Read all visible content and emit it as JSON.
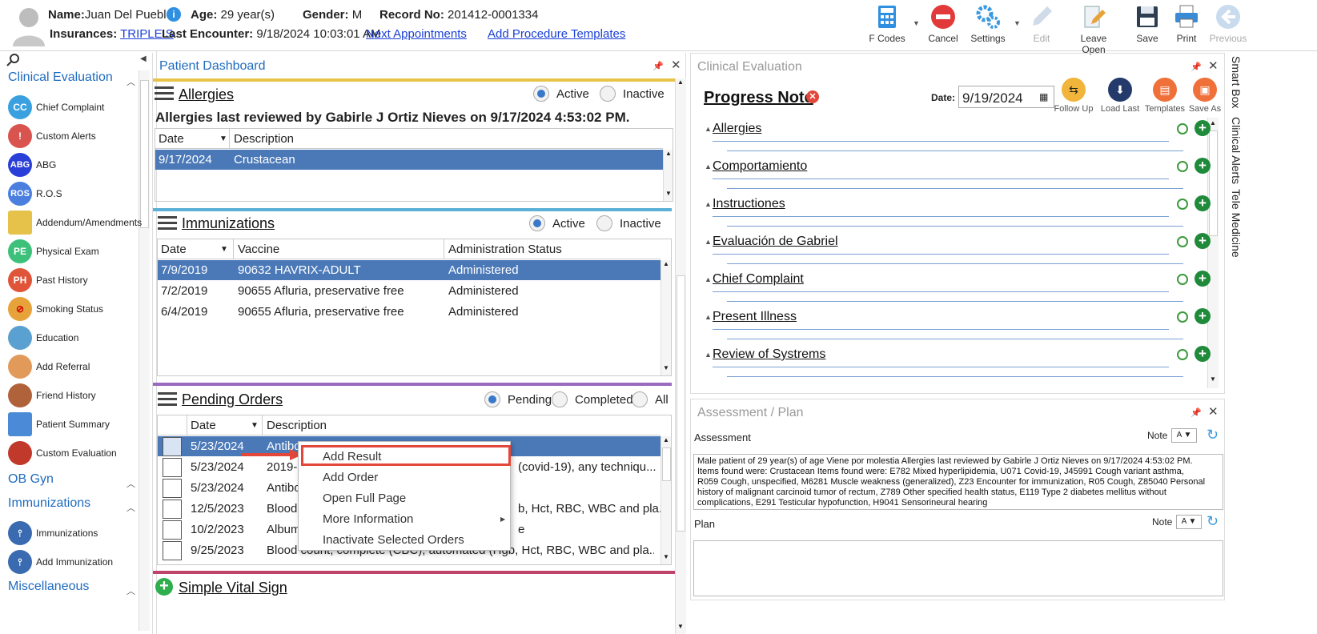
{
  "patient": {
    "name_label": "Name:",
    "name": "Juan Del Pueblo",
    "age_label": "Age:",
    "age": "29 year(s)",
    "gender_label": "Gender:",
    "gender": "M",
    "record_label": "Record No:",
    "record": "201412-0001334",
    "insurances_label": "Insurances:",
    "insurance": "TRIPLE S",
    "last_encounter_label": "Last Encounter:",
    "last_encounter": "9/18/2024 10:03:01 AM",
    "next_appointments": "Next Appointments",
    "add_procedure_templates": "Add Procedure Templates"
  },
  "toolbar": {
    "fcodes": "F Codes",
    "cancel": "Cancel",
    "settings": "Settings",
    "edit": "Edit",
    "leave_open": "Leave Open",
    "save": "Save",
    "print": "Print",
    "previous": "Previous"
  },
  "sidebar": {
    "sections": [
      "Clinical Evaluation",
      "OB Gyn",
      "Immunizations",
      "Miscellaneous"
    ],
    "items": [
      {
        "label": "Chief Complaint",
        "badge": "CC",
        "color": "#3aa0e0"
      },
      {
        "label": "Custom Alerts",
        "badge": "!",
        "color": "#d9534f"
      },
      {
        "label": "ABG",
        "badge": "ABG",
        "color": "#2a3fd8"
      },
      {
        "label": "R.O.S",
        "badge": "ROS",
        "color": "#4a7fe0"
      },
      {
        "label": "Addendum/Amendments",
        "badge": "",
        "color": "#e6c24a"
      },
      {
        "label": "Physical Exam",
        "badge": "PE",
        "color": "#3cc07a"
      },
      {
        "label": "Past History",
        "badge": "PH",
        "color": "#e0553a"
      },
      {
        "label": "Smoking Status",
        "badge": "⊘",
        "color": "#e8a23a"
      },
      {
        "label": "Education",
        "badge": "",
        "color": "#5aa0d0"
      },
      {
        "label": "Add Referral",
        "badge": "",
        "color": "#e29a5a"
      },
      {
        "label": "Friend History",
        "badge": "",
        "color": "#b0623a"
      },
      {
        "label": "Patient Summary",
        "badge": "",
        "color": "#4a8ad6"
      },
      {
        "label": "Custom Evaluation",
        "badge": "",
        "color": "#c0392b"
      }
    ],
    "imm_items": [
      {
        "label": "Immunizations",
        "color": "#3a6ab0"
      },
      {
        "label": "Add Immunization",
        "color": "#3a6ab0"
      }
    ]
  },
  "dashboard": {
    "title": "Patient Dashboard",
    "allergies": {
      "title": "Allergies",
      "active": "Active",
      "inactive": "Inactive",
      "reviewed": "Allergies last reviewed by Gabirle J Ortiz Nieves on 9/17/2024 4:53:02 PM.",
      "columns": [
        "Date",
        "Description"
      ],
      "rows": [
        [
          "9/17/2024",
          "Crustacean"
        ]
      ]
    },
    "immunizations": {
      "title": "Immunizations",
      "active": "Active",
      "inactive": "Inactive",
      "columns": [
        "Date",
        "Vaccine",
        "Administration Status"
      ],
      "rows": [
        [
          "7/9/2019",
          "90632 HAVRIX-ADULT",
          "Administered"
        ],
        [
          "7/2/2019",
          "90655 Afluria, preservative free",
          "Administered"
        ],
        [
          "6/4/2019",
          "90655 Afluria, preservative free",
          "Administered"
        ]
      ]
    },
    "orders": {
      "title": "Pending Orders",
      "pending": "Pending",
      "completed": "Completed",
      "all": "All",
      "columns": [
        "Date",
        "Description"
      ],
      "rows": [
        [
          "5/23/2024",
          "Antibo"
        ],
        [
          "5/23/2024",
          "2019-("
        ],
        [
          "5/23/2024",
          "Antibo"
        ],
        [
          "12/5/2023",
          "Blood"
        ],
        [
          "10/2/2023",
          "Album"
        ],
        [
          "9/25/2023",
          "Blood count, complete (CBC), automated (Hgb, Hct, RBC, WBC and pla..."
        ]
      ],
      "tails": [
        "(covid-19), any techniqu...",
        "b, Hct, RBC, WBC and pla...",
        "e"
      ]
    },
    "simple_vital": "Simple Vital Sign"
  },
  "context_menu": [
    "Add Result",
    "Add Order",
    "Open Full Page",
    "More Information",
    "Inactivate Selected Orders"
  ],
  "clinical": {
    "title": "Clinical Evaluation",
    "note_title": "Progress Note",
    "date_label": "Date:",
    "date": "9/19/2024",
    "actions": [
      "Follow Up",
      "Load Last",
      "Templates",
      "Save As"
    ],
    "sections": [
      "Allergies",
      "Comportamiento",
      "Instructiones",
      "Evaluación de Gabriel",
      "Chief Complaint",
      "Present Illness",
      "Review of Systrems"
    ]
  },
  "right_tabs": [
    "Smart Box",
    "Clinical Alerts",
    "Tele Medicine"
  ],
  "assessment": {
    "title": "Assessment / Plan",
    "assessment_label": "Assessment",
    "note_label": "Note",
    "text": "Male patient of 29 year(s) of age Viene por molestia     Allergies last reviewed by Gabirle J Ortiz Nieves on 9/17/2024 4:53:02 PM.    Items found were:  Crustacean  Items found were:  E782 Mixed hyperlipidemia, U071 Covid-19, J45991 Cough variant asthma, R059 Cough, unspecified, M6281 Muscle weakness (generalized), Z23 Encounter for immunization, R05 Cough, Z85040 Personal history of malignant carcinoid tumor of rectum, Z789 Other specified health status, E119 Type 2 diabetes mellitus without complications, E291 Testicular hypofunction, H9041 Sensorineural hearing",
    "plan_label": "Plan"
  }
}
